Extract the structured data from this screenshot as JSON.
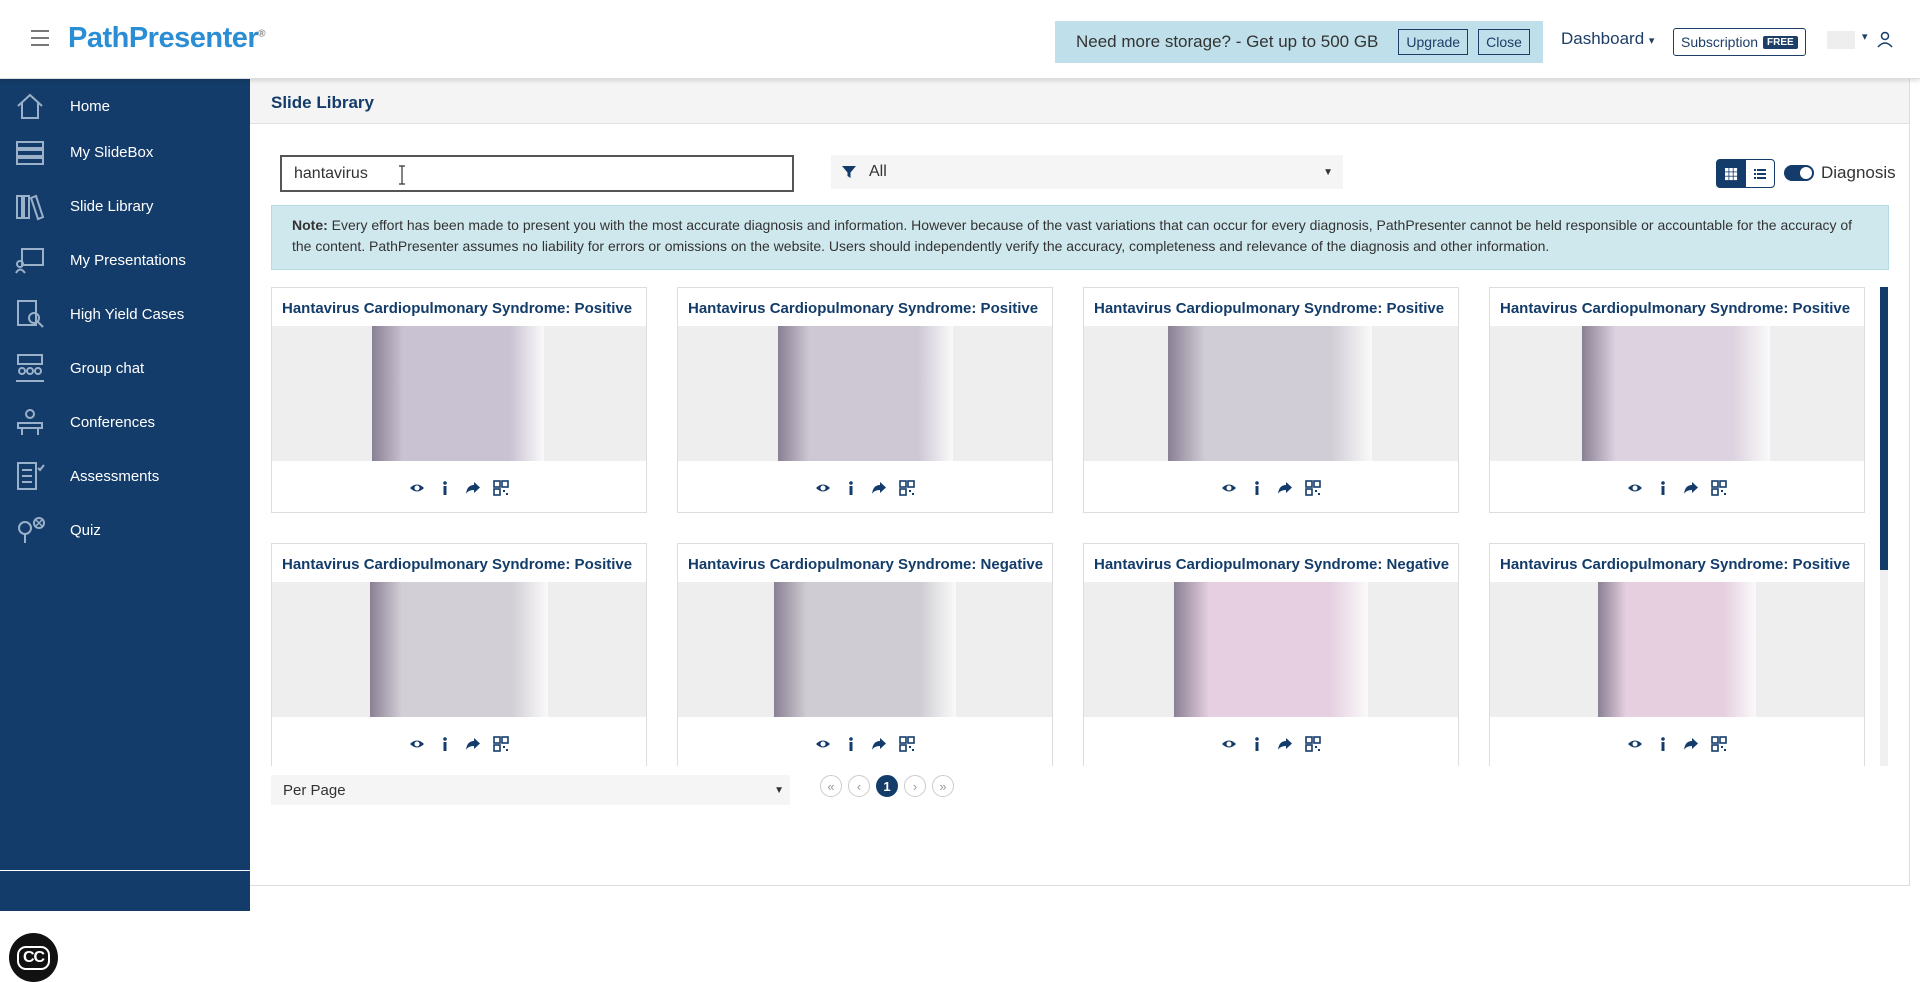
{
  "header": {
    "brand": "PathPresenter",
    "storage_banner": {
      "text": "Need more storage? - Get up to 500 GB",
      "upgrade_label": "Upgrade",
      "close_label": "Close"
    },
    "dashboard_label": "Dashboard",
    "subscription_label": "Subscription",
    "subscription_badge": "FREE"
  },
  "sidebar": {
    "items": [
      {
        "label": "Home",
        "icon": "home-icon",
        "active": false
      },
      {
        "label": "My SlideBox",
        "icon": "slidebox-icon",
        "active": false
      },
      {
        "label": "Slide Library",
        "icon": "slide-library-icon",
        "active": true
      },
      {
        "label": "My Presentations",
        "icon": "presentations-icon",
        "active": false
      },
      {
        "label": "High Yield Cases",
        "icon": "high-yield-cases-icon",
        "active": false
      },
      {
        "label": "Group chat",
        "icon": "group-chat-icon",
        "active": false
      },
      {
        "label": "Conferences",
        "icon": "conferences-icon",
        "active": false
      },
      {
        "label": "Assessments",
        "icon": "assessments-icon",
        "active": false
      },
      {
        "label": "Quiz",
        "icon": "quiz-icon",
        "active": false
      }
    ],
    "cc_label": "CC"
  },
  "main": {
    "title": "Slide Library",
    "search": {
      "value": "hantavirus",
      "placeholder": ""
    },
    "filter": {
      "selected": "All"
    },
    "view_toggle": {
      "active": "grid"
    },
    "diagnosis_toggle": {
      "label": "Diagnosis",
      "on": true
    },
    "note": {
      "label": "Note:",
      "text": "Every effort has been made to present you with the most accurate diagnosis and information. However because of the vast variations that can occur for every diagnosis, PathPresenter cannot be held responsible or accountable for the accuracy of the content. PathPresenter assumes no liability for errors or omissions on the website. Users should independently verify the accuracy, completeness and relevance of the diagnosis and other information."
    },
    "cards": [
      {
        "title": "Hantavirus Cardiopulmonary Syndrome: Positive",
        "tint": "#c9c2d2"
      },
      {
        "title": "Hantavirus Cardiopulmonary Syndrome: Positive",
        "tint": "#cdc8d4"
      },
      {
        "title": "Hantavirus Cardiopulmonary Syndrome: Positive",
        "tint": "#d0cdd6"
      },
      {
        "title": "Hantavirus Cardiopulmonary Syndrome: Positive",
        "tint": "#ddd2df"
      },
      {
        "title": "Hantavirus Cardiopulmonary Syndrome: Positive",
        "tint": "#d3cfd6"
      },
      {
        "title": "Hantavirus Cardiopulmonary Syndrome: Negative",
        "tint": "#cfcdd3"
      },
      {
        "title": "Hantavirus Cardiopulmonary Syndrome: Negative",
        "tint": "#e5cfe0"
      },
      {
        "title": "Hantavirus Cardiopulmonary Syndrome: Positive",
        "tint": "#e6d0e0"
      }
    ],
    "per_page_label": "Per Page",
    "pagination": {
      "first": "«",
      "prev": "‹",
      "current": "1",
      "next": "›",
      "last": "»"
    }
  },
  "colors": {
    "primary": "#143c6a",
    "brand": "#2b8ed4",
    "banner": "#bfe0ea",
    "note_bg": "#cfe8ee"
  }
}
